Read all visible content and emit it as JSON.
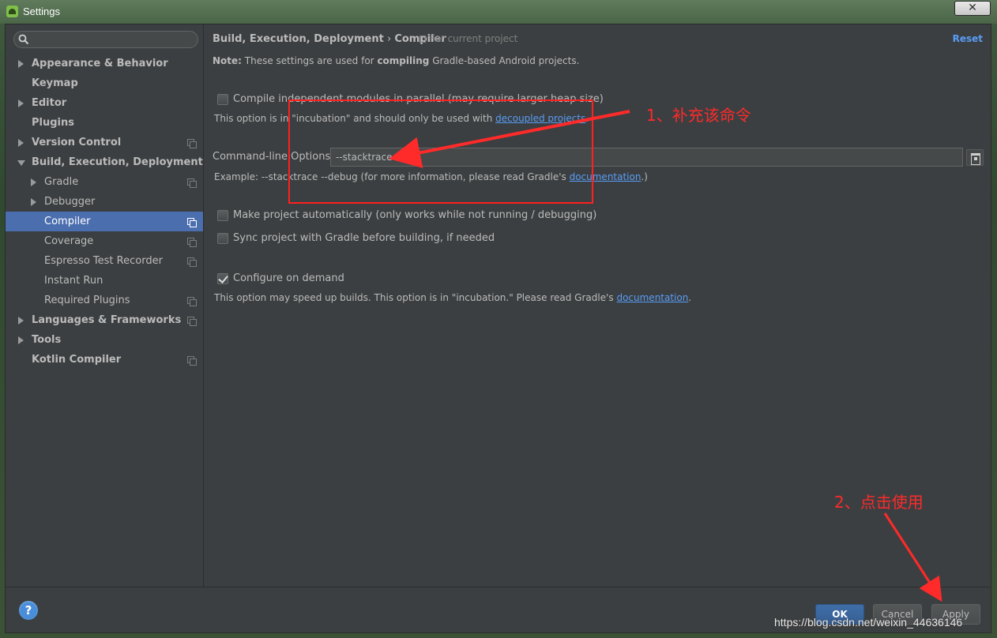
{
  "window": {
    "title": "Settings",
    "close_glyph": "✕"
  },
  "search": {
    "placeholder": ""
  },
  "sidebar": {
    "items": [
      {
        "label": "Appearance & Behavior"
      },
      {
        "label": "Keymap"
      },
      {
        "label": "Editor"
      },
      {
        "label": "Plugins"
      },
      {
        "label": "Version Control"
      },
      {
        "label": "Build, Execution, Deployment"
      },
      {
        "label": "Gradle"
      },
      {
        "label": "Debugger"
      },
      {
        "label": "Compiler"
      },
      {
        "label": "Coverage"
      },
      {
        "label": "Espresso Test Recorder"
      },
      {
        "label": "Instant Run"
      },
      {
        "label": "Required Plugins"
      },
      {
        "label": "Languages & Frameworks"
      },
      {
        "label": "Tools"
      },
      {
        "label": "Kotlin Compiler"
      }
    ]
  },
  "header": {
    "crumb_parent": "Build, Execution, Deployment",
    "crumb_sep": "›",
    "crumb_current": "Compiler",
    "scope_label": "For current project",
    "reset_label": "Reset"
  },
  "note": {
    "prefix": "Note:",
    "text_1": " These settings are used for ",
    "emphasis": "compiling",
    "text_2": " Gradle-based Android projects."
  },
  "options": {
    "parallel": {
      "label": "Compile independent modules in parallel (may require larger heap size)",
      "checked": false,
      "hint_prefix": "This option is in \"incubation\" and should only be used with ",
      "hint_link": "decoupled projects",
      "hint_suffix": "."
    },
    "cmdline": {
      "label": "Command-line Options:",
      "value": "--stacktrace",
      "hint_prefix": "Example: --stacktrace --debug (for more information, please read Gradle's ",
      "hint_link": "documentation",
      "hint_suffix": ".)"
    },
    "make_auto": {
      "label": "Make project automatically (only works while not running / debugging)",
      "checked": false
    },
    "sync": {
      "label": "Sync project with Gradle before building, if needed",
      "checked": false
    },
    "configure_demand": {
      "label": "Configure on demand",
      "checked": true,
      "hint_prefix": "This option may speed up builds. This option is in \"incubation.\" Please read Gradle's ",
      "hint_link": "documentation",
      "hint_suffix": "."
    }
  },
  "footer": {
    "help_label": "?",
    "ok_label": "OK",
    "cancel_label": "Cancel",
    "apply_label": "Apply"
  },
  "annotations": {
    "step1": "1、补充该命令",
    "step2": "2、点击使用",
    "watermark": "https://blog.csdn.net/weixin_44636146"
  },
  "colors": {
    "accent": "#4b6eaf",
    "link": "#589df6",
    "annotation": "#ff2a2a"
  }
}
